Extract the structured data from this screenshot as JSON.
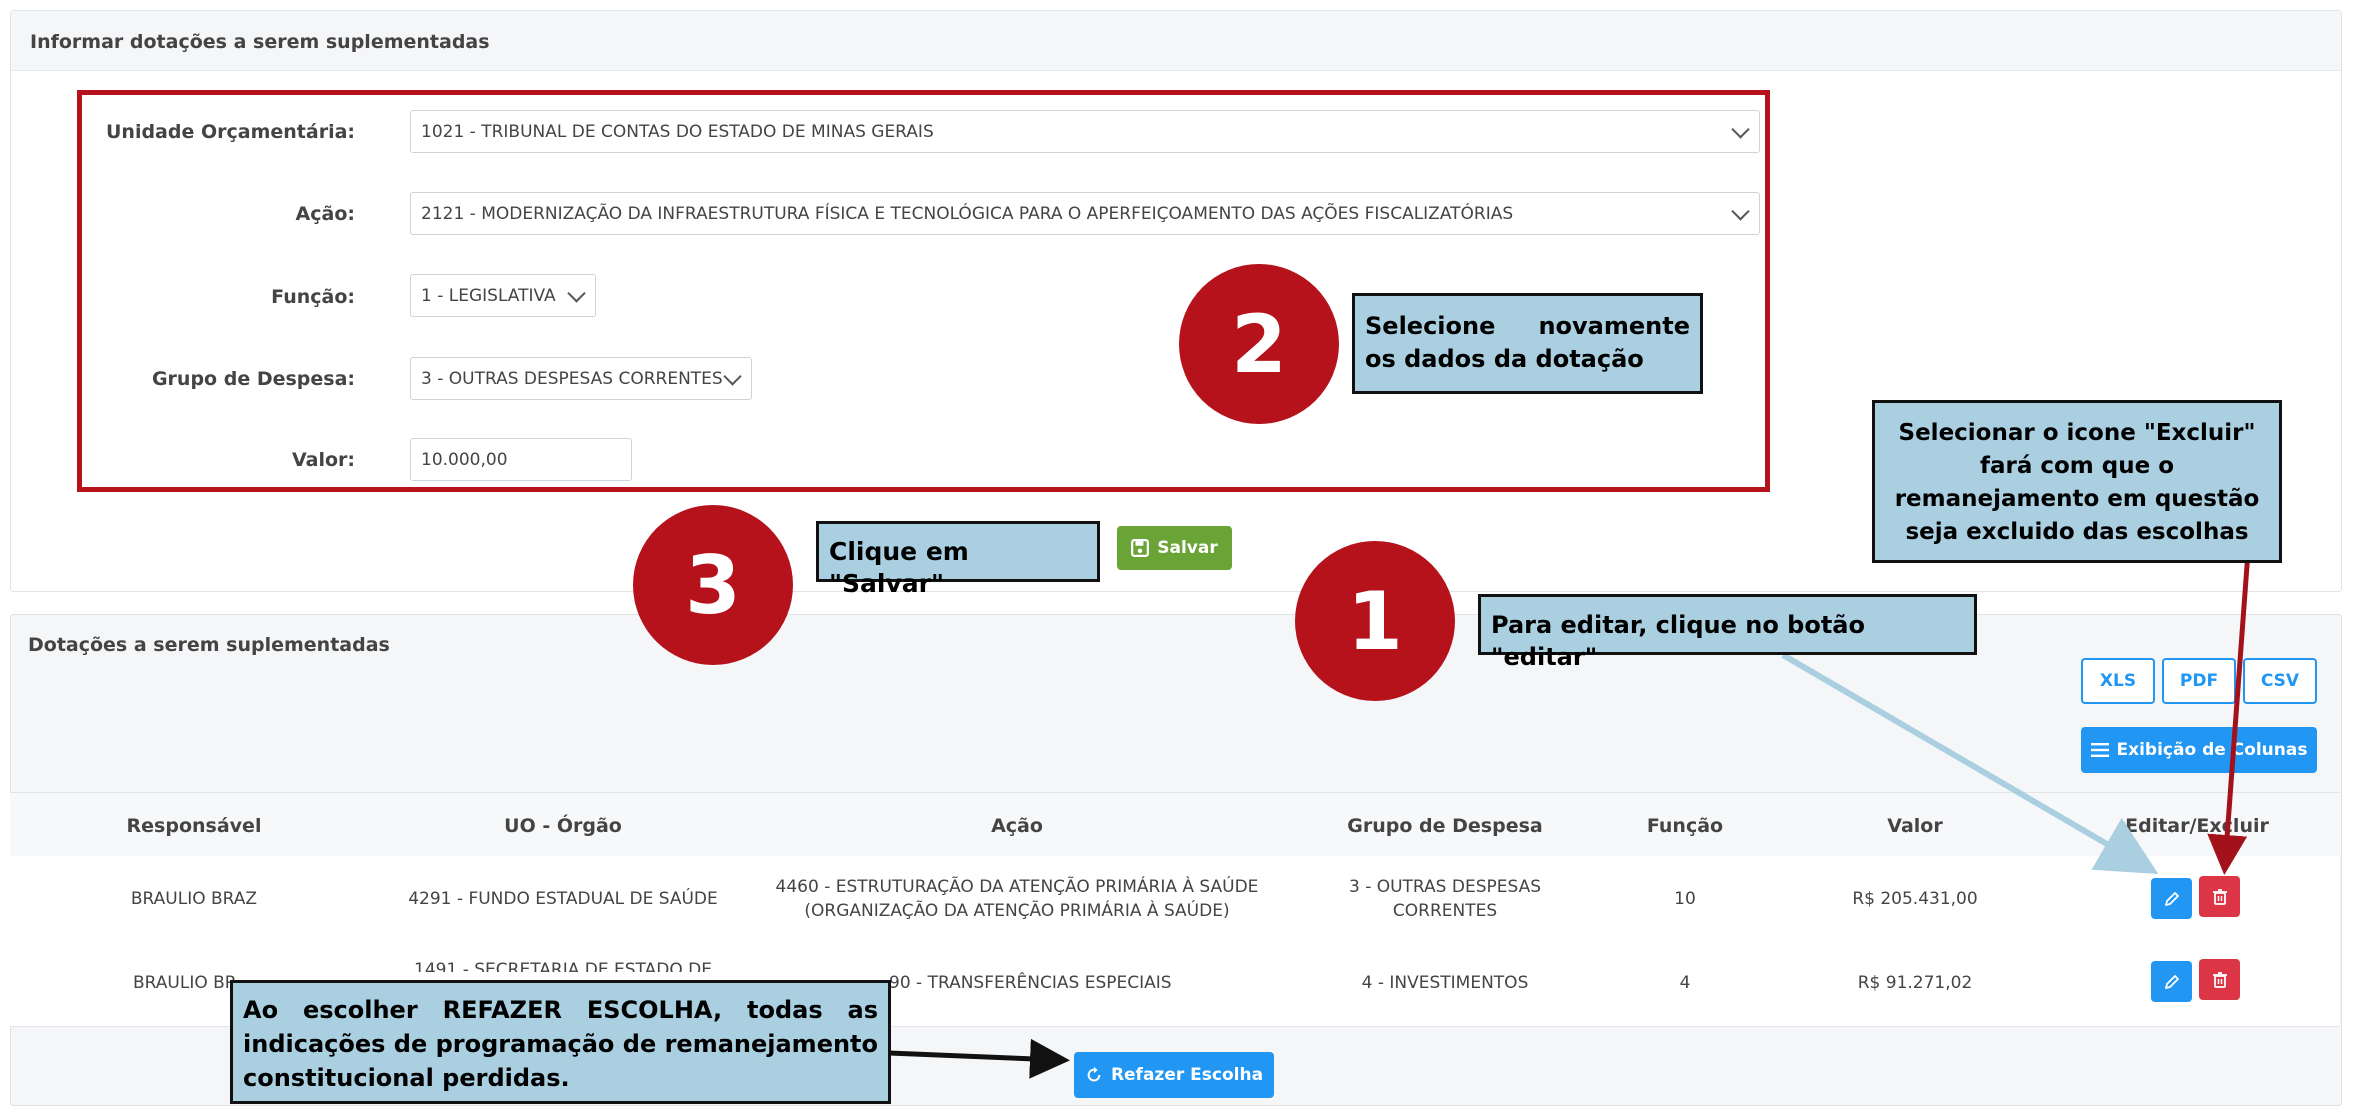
{
  "form_panel": {
    "title": "Informar dotações a serem suplementadas",
    "fields": {
      "unidade_label": "Unidade Orçamentária:",
      "unidade_value": "1021 - TRIBUNAL DE CONTAS DO ESTADO DE MINAS GERAIS",
      "acao_label": "Ação:",
      "acao_value": "2121 - MODERNIZAÇÃO DA INFRAESTRUTURA FÍSICA E TECNOLÓGICA PARA O APERFEIÇOAMENTO DAS AÇÕES FISCALIZATÓRIAS",
      "funcao_label": "Função:",
      "funcao_value": "1 - LEGISLATIVA",
      "grupo_label": "Grupo de Despesa:",
      "grupo_value": "3 - OUTRAS DESPESAS CORRENTES",
      "valor_label": "Valor:",
      "valor_value": "10.000,00"
    },
    "save_label": "Salvar"
  },
  "list_panel": {
    "title": "Dotações a serem suplementadas",
    "export_buttons": [
      "XLS",
      "PDF",
      "CSV"
    ],
    "columns_button": "Exibição de Colunas",
    "headers": [
      "Responsável",
      "UO - Órgão",
      "Ação",
      "Grupo de Despesa",
      "Função",
      "Valor",
      "Editar/Excluir"
    ],
    "rows": [
      {
        "responsavel": "BRAULIO BRAZ",
        "uo": "4291 - FUNDO ESTADUAL DE SAÚDE",
        "acao": "4460 - ESTRUTURAÇÃO DA ATENÇÃO PRIMÁRIA À SAÚDE (ORGANIZAÇÃO DA ATENÇÃO PRIMÁRIA À SAÚDE)",
        "grupo": "3 - OUTRAS DESPESAS CORRENTES",
        "funcao": "10",
        "valor": "R$ 205.431,00"
      },
      {
        "responsavel": "BRAULIO BR",
        "uo": "1491 - SECRETARIA DE ESTADO DE",
        "acao": "90 - TRANSFERÊNCIAS ESPECIAIS",
        "grupo": "4 - INVESTIMENTOS",
        "funcao": "4",
        "valor": "R$ 91.271,02"
      }
    ],
    "redo_label": "Refazer Escolha"
  },
  "annotations": {
    "step2_number": "2",
    "step2_text": "Selecione novamente os dados da dotação",
    "step3_number": "3",
    "step3_text": "Clique em \"Salvar\"",
    "step1_number": "1",
    "step1_text": "Para editar, clique no botão \"editar\"",
    "excluir_text": "Selecionar o icone \"Excluir\" fará com que o remanejamento em questão seja excluido das escolhas",
    "refazer_text": "Ao escolher REFAZER ESCOLHA, todas as indicações de programação de remanejamento constitucional perdidas."
  },
  "colors": {
    "red_circle": "#b5121b",
    "callout_bg": "#a9cfe0",
    "primary_blue": "#2196f3",
    "save_green": "#6aa436",
    "delete_red": "#dc3545"
  }
}
